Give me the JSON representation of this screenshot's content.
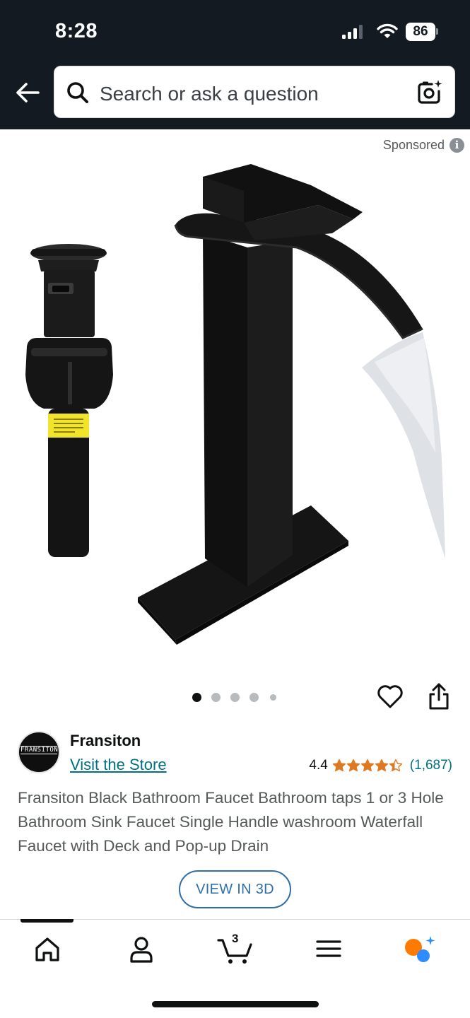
{
  "status_bar": {
    "time": "8:28",
    "battery": "86",
    "icons": [
      "signal-icon",
      "wifi-icon",
      "battery-icon"
    ]
  },
  "header": {
    "back_icon": "back-arrow-icon",
    "search": {
      "placeholder": "Search or ask a question",
      "icon": "search-icon",
      "camera_icon": "camera-search-icon"
    }
  },
  "sponsored": {
    "label": "Sponsored",
    "info_icon_glyph": "i"
  },
  "gallery": {
    "image_count": 5,
    "active_index": 0,
    "wishlist_icon": "heart-icon",
    "share_icon": "share-icon"
  },
  "brand": {
    "name": "Fransiton",
    "logo_text": "FRANSITON",
    "visit_store": "Visit the Store"
  },
  "rating": {
    "value": "4.4",
    "stars": 4.4,
    "count": "(1,687)"
  },
  "product": {
    "title": "Fransiton Black Bathroom Faucet Bathroom taps 1 or 3 Hole Bathroom Sink Faucet Single Handle washroom Waterfall Faucet with Deck and Pop-up Drain",
    "view_3d": "VIEW IN 3D"
  },
  "bottom_nav": {
    "items": [
      "home-icon",
      "account-icon",
      "cart-icon",
      "menu-icon",
      "rufus-icon"
    ],
    "cart_count": "3",
    "active": "home-icon"
  },
  "colors": {
    "header_bg": "#131a22",
    "link": "#007185",
    "star": "#de7921",
    "view3d": "#2f6fa7",
    "rufus_orange": "#ff7a00",
    "rufus_blue": "#2d8cff"
  }
}
